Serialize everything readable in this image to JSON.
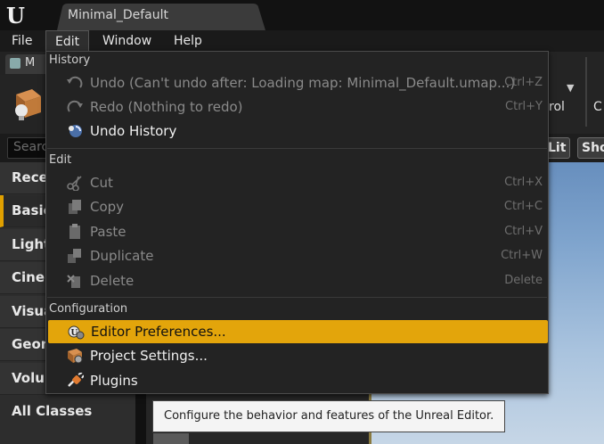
{
  "app": {
    "logo_icon": "unreal-engine-logo",
    "document_tab": "Minimal_Default"
  },
  "menubar": {
    "items": [
      {
        "label": "File"
      },
      {
        "label": "Edit"
      },
      {
        "label": "Window"
      },
      {
        "label": "Help"
      }
    ]
  },
  "modes_panel": {
    "tab_label": "M",
    "search_placeholder": "Search",
    "categories": [
      {
        "label": "Rece"
      },
      {
        "label": "Basic",
        "selected": true
      },
      {
        "label": "Light"
      },
      {
        "label": "Ciner"
      },
      {
        "label": "Visua"
      },
      {
        "label": "Geon"
      },
      {
        "label": "Volur"
      },
      {
        "label": "All Classes"
      }
    ]
  },
  "viewport": {
    "lit_button": "Lit",
    "show_button": "Sho",
    "toolbar_fragment_1": "rol",
    "toolbar_fragment_2": "C"
  },
  "edit_menu": {
    "sections": {
      "history": "History",
      "edit": "Edit",
      "configuration": "Configuration"
    },
    "history_items": [
      {
        "label": "Undo (Can't undo after: Loading map: Minimal_Default.umap...)",
        "shortcut": "Ctrl+Z",
        "icon": "undo-icon",
        "enabled": false
      },
      {
        "label": "Redo (Nothing to redo)",
        "shortcut": "Ctrl+Y",
        "icon": "redo-icon",
        "enabled": false
      },
      {
        "label": "Undo History",
        "shortcut": "",
        "icon": "undo-history-icon",
        "enabled": true
      }
    ],
    "edit_items": [
      {
        "label": "Cut",
        "shortcut": "Ctrl+X",
        "icon": "cut-icon",
        "enabled": false
      },
      {
        "label": "Copy",
        "shortcut": "Ctrl+C",
        "icon": "copy-icon",
        "enabled": false
      },
      {
        "label": "Paste",
        "shortcut": "Ctrl+V",
        "icon": "paste-icon",
        "enabled": false
      },
      {
        "label": "Duplicate",
        "shortcut": "Ctrl+W",
        "icon": "duplicate-icon",
        "enabled": false
      },
      {
        "label": "Delete",
        "shortcut": "Delete",
        "icon": "delete-icon",
        "enabled": false
      }
    ],
    "config_items": [
      {
        "label": "Editor Preferences...",
        "icon": "editor-preferences-icon",
        "highlighted": true
      },
      {
        "label": "Project Settings...",
        "icon": "project-settings-icon"
      },
      {
        "label": "Plugins",
        "icon": "plugins-icon"
      }
    ]
  },
  "tooltip": {
    "text": "Configure the behavior and features of the Unreal Editor."
  },
  "colors": {
    "highlight": "#e3a50b",
    "menu_bg": "#232323",
    "selected_accent": "#e0a000"
  }
}
